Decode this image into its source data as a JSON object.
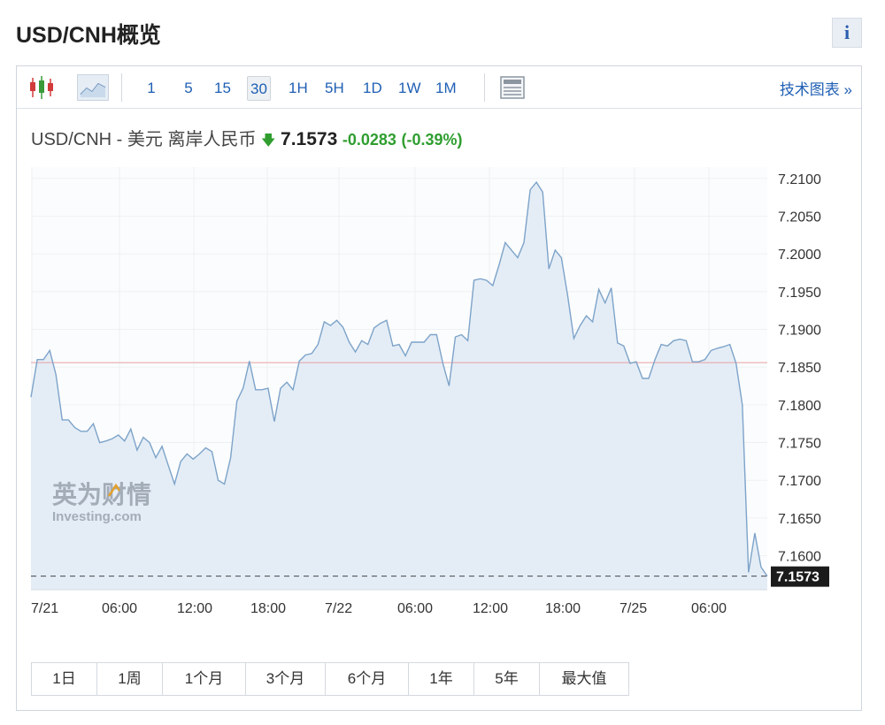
{
  "header": {
    "title": "USD/CNH概览",
    "info_label": "i"
  },
  "toolbar": {
    "periods": [
      "1",
      "5",
      "15",
      "30",
      "1H",
      "5H",
      "1D",
      "1W",
      "1M"
    ],
    "active_period": "30",
    "tech_chart_label": "技术图表 »"
  },
  "quote": {
    "name": "USD/CNH - 美元 离岸人民币",
    "arrow": "🡇",
    "price": "7.1573",
    "change": "-0.0283",
    "change_pct": "(-0.39%)"
  },
  "watermark": {
    "cn": "英为财情",
    "en": "Investing.com"
  },
  "colors": {
    "line": "#7da3c9",
    "fill": "#e4edf6",
    "prev_close": "#e8a0a0",
    "accent": "#1f5fb4",
    "up": "#2f9e2f",
    "last_bg": "#1b1b1b"
  },
  "chart_data": {
    "type": "area",
    "title": "",
    "xlabel": "",
    "ylabel": "",
    "ylim": [
      7.1555,
      7.2115
    ],
    "y_ticks": [
      7.21,
      7.205,
      7.2,
      7.195,
      7.19,
      7.185,
      7.18,
      7.175,
      7.17,
      7.165,
      7.16
    ],
    "y_tick_labels": [
      "7.2100",
      "7.2050",
      "7.2000",
      "7.1950",
      "7.1900",
      "7.1850",
      "7.1800",
      "7.1750",
      "7.1700",
      "7.1650",
      "7.1600"
    ],
    "x_tick_labels": [
      "7/21",
      "06:00",
      "12:00",
      "18:00",
      "7/22",
      "06:00",
      "12:00",
      "18:00",
      "7/25",
      "06:00"
    ],
    "previous_close": 7.1856,
    "last_value": 7.1573,
    "last_value_label": "7.1573",
    "grid": true,
    "series": [
      {
        "values": [
          7.181,
          7.186,
          7.186,
          7.1872,
          7.184,
          7.178,
          7.178,
          7.177,
          7.1765,
          7.1765,
          7.1775,
          7.175,
          7.1752,
          7.1755,
          7.176,
          7.1752,
          7.1768,
          7.174,
          7.1757,
          7.175,
          7.173,
          7.1745,
          7.172,
          7.1695,
          7.1725,
          7.1735,
          7.1728,
          7.1735,
          7.1743,
          7.1738,
          7.17,
          7.1695,
          7.173,
          7.1805,
          7.1822,
          7.1858,
          7.182,
          7.182,
          7.1822,
          7.1778,
          7.1822,
          7.183,
          7.182,
          7.1858,
          7.1866,
          7.1868,
          7.188,
          7.191,
          7.1905,
          7.1912,
          7.1903,
          7.1883,
          7.187,
          7.1885,
          7.188,
          7.1902,
          7.1908,
          7.1912,
          7.1878,
          7.188,
          7.1865,
          7.1883,
          7.1883,
          7.1883,
          7.1893,
          7.1893,
          7.1855,
          7.1825,
          7.189,
          7.1893,
          7.1885,
          7.1965,
          7.1967,
          7.1965,
          7.1958,
          7.1985,
          7.2015,
          7.2005,
          7.1995,
          7.2015,
          7.2085,
          7.2095,
          7.2082,
          7.198,
          7.2005,
          7.1995,
          7.1945,
          7.1888,
          7.1905,
          7.1918,
          7.191,
          7.1953,
          7.1935,
          7.1955,
          7.1882,
          7.1878,
          7.1855,
          7.1857,
          7.1835,
          7.1835,
          7.186,
          7.188,
          7.1878,
          7.1885,
          7.1887,
          7.1885,
          7.1857,
          7.1857,
          7.186,
          7.1872,
          7.1875,
          7.1877,
          7.188,
          7.1855,
          7.18,
          7.1578,
          7.163,
          7.1585,
          7.1573
        ]
      }
    ]
  },
  "ranges": [
    "1日",
    "1周",
    "1个月",
    "3个月",
    "6个月",
    "1年",
    "5年",
    "最大值"
  ]
}
